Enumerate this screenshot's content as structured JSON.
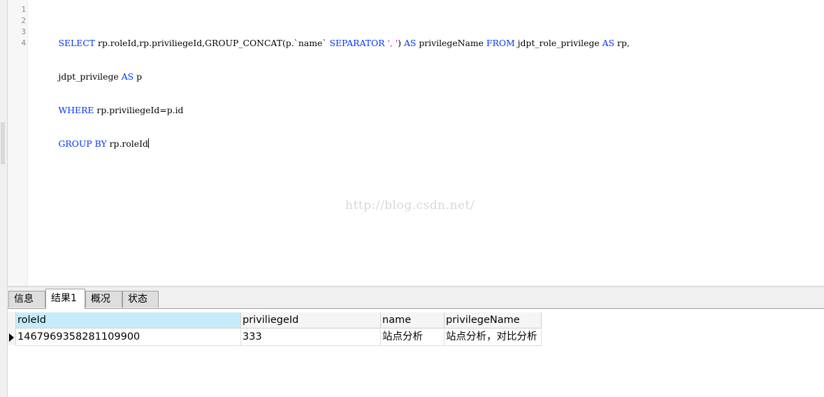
{
  "editor": {
    "line_numbers": [
      "1",
      "2",
      "3",
      "4"
    ],
    "lines": [
      [
        {
          "t": "SELECT",
          "k": "kw"
        },
        {
          "t": " rp.roleId,rp.priviliegeId,GROUP_CONCAT(p.`name` ",
          "k": ""
        },
        {
          "t": "SEPARATOR",
          "k": "kw"
        },
        {
          "t": " ",
          "k": ""
        },
        {
          "t": "', '",
          "k": "str"
        },
        {
          "t": ") ",
          "k": ""
        },
        {
          "t": "AS",
          "k": "kw"
        },
        {
          "t": " privilegeName ",
          "k": ""
        },
        {
          "t": "FROM",
          "k": "kw"
        },
        {
          "t": " jdpt_role_privilege ",
          "k": ""
        },
        {
          "t": "AS",
          "k": "kw"
        },
        {
          "t": " rp,",
          "k": ""
        }
      ],
      [
        {
          "t": "jdpt_privilege ",
          "k": ""
        },
        {
          "t": "AS",
          "k": "kw"
        },
        {
          "t": " p",
          "k": ""
        }
      ],
      [
        {
          "t": "WHERE",
          "k": "kw"
        },
        {
          "t": " rp.priviliegeId=p.id",
          "k": ""
        }
      ],
      [
        {
          "t": "GROUP BY",
          "k": "kw"
        },
        {
          "t": " rp.roleId",
          "k": ""
        }
      ]
    ],
    "watermark": "http://blog.csdn.net/"
  },
  "tabs": [
    {
      "label": "信息",
      "active": false
    },
    {
      "label": "结果1",
      "active": true
    },
    {
      "label": "概况",
      "active": false
    },
    {
      "label": "状态",
      "active": false
    }
  ],
  "results": {
    "columns": [
      "roleId",
      "priviliegeId",
      "name",
      "privilegeName"
    ],
    "selected_column": "roleId",
    "rows": [
      [
        "1467969358281109900",
        "333",
        "站点分析",
        "站点分析，对比分析"
      ]
    ]
  },
  "colors": {
    "keyword": "#0033ff",
    "string": "#ff00ff",
    "selected_header": "#c6ecfa"
  }
}
